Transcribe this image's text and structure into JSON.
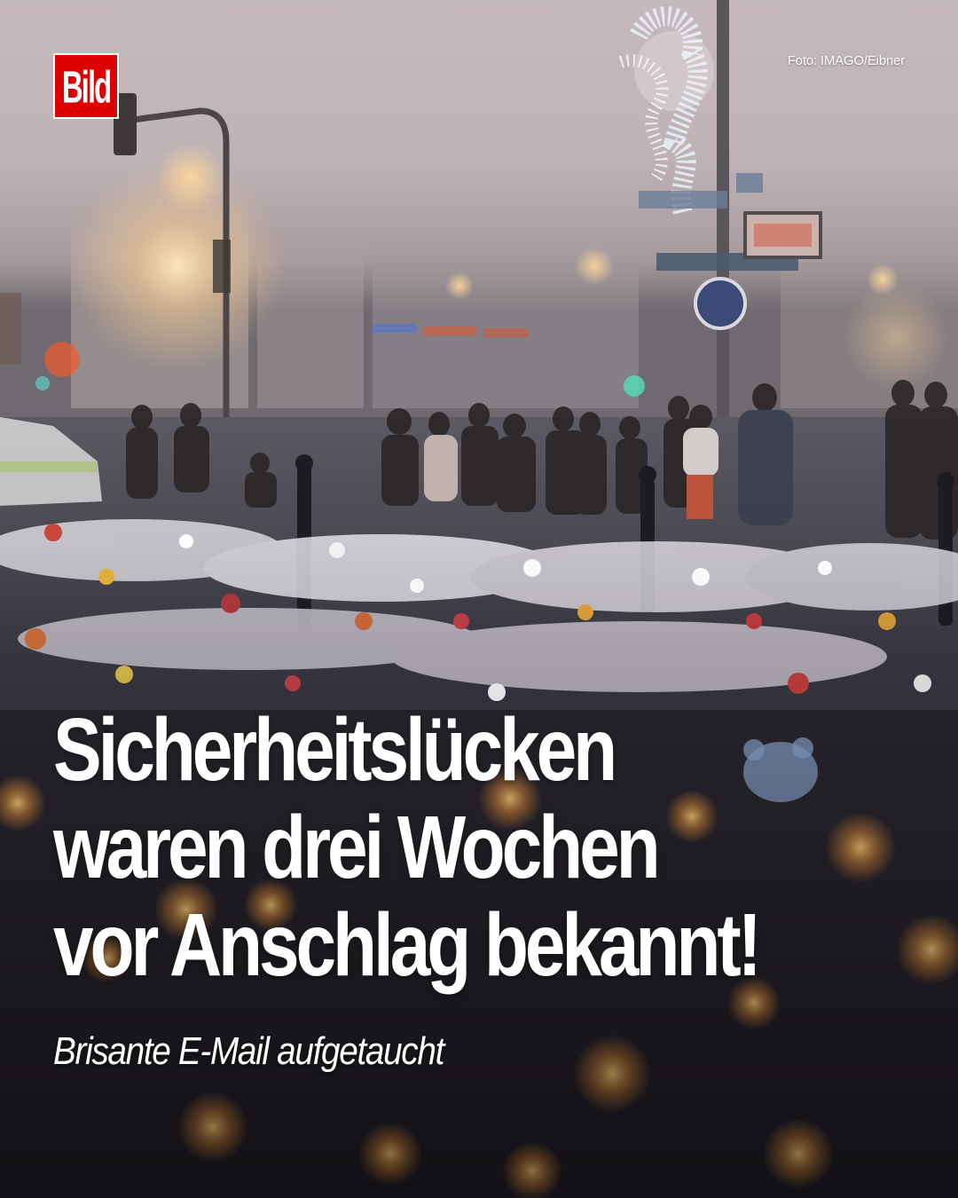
{
  "brand": {
    "logo_text": "Bild",
    "logo_color": "#dd0000"
  },
  "photo": {
    "credit": "Foto: IMAGO/Eibner"
  },
  "headline": {
    "lines": [
      "Sicherheitslücken",
      "waren drei Wochen",
      "vor Anschlag bekannt!"
    ]
  },
  "subline": "Brisante E-Mail aufgetaucht",
  "colors": {
    "text": "#ffffff",
    "sky": "#c9bcc0"
  }
}
